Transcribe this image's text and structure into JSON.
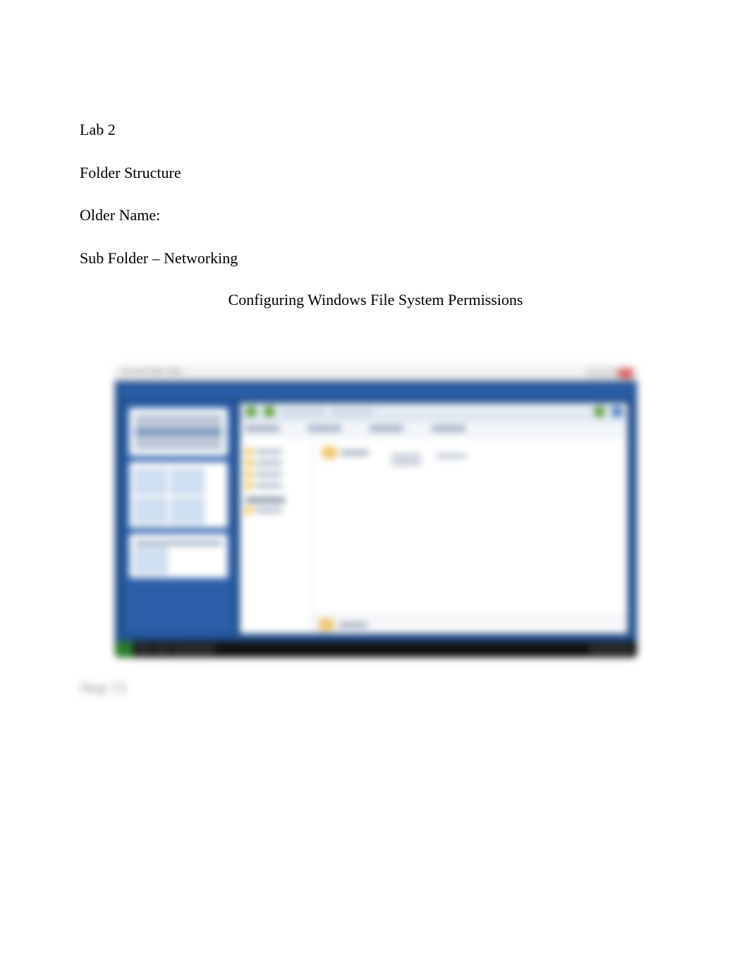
{
  "doc": {
    "line1": "Lab 2",
    "line2": "Folder Structure",
    "line3": "Older Name:",
    "line4": "Sub Folder – Networking",
    "heading": "Configuring Windows File System Permissions",
    "step_label": "Step 15"
  },
  "screenshot": {
    "window_title": "File and Folder Tasks"
  }
}
